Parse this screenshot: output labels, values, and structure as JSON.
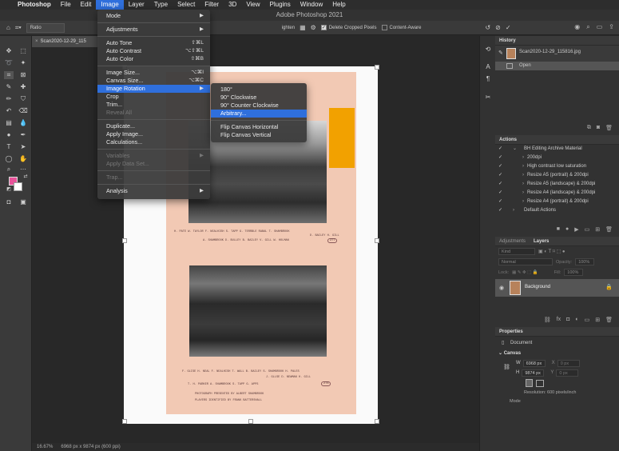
{
  "menubar": {
    "apple": "",
    "app_name": "Photoshop",
    "items": [
      "File",
      "Edit",
      "Image",
      "Layer",
      "Type",
      "Select",
      "Filter",
      "3D",
      "View",
      "Plugins",
      "Window",
      "Help"
    ],
    "active": "Image"
  },
  "window_title": "Adobe Photoshop 2021",
  "options_bar": {
    "ratio_label": "Ratio",
    "straighten_label": "ighten",
    "delete_cropped_label": "Delete Cropped Pixels",
    "delete_cropped_checked": true,
    "content_aware_label": "Content-Aware",
    "content_aware_checked": false
  },
  "document_tab": {
    "name": "Scan2020-12-29_115",
    "close": "×"
  },
  "image_menu": {
    "items": [
      {
        "label": "Mode",
        "shortcut": "",
        "submenu": true
      },
      {
        "sep": true
      },
      {
        "label": "Adjustments",
        "shortcut": "",
        "submenu": true
      },
      {
        "sep": true
      },
      {
        "label": "Auto Tone",
        "shortcut": "⇧⌘L"
      },
      {
        "label": "Auto Contrast",
        "shortcut": "⌥⇧⌘L"
      },
      {
        "label": "Auto Color",
        "shortcut": "⇧⌘B"
      },
      {
        "sep": true
      },
      {
        "label": "Image Size...",
        "shortcut": "⌥⌘I"
      },
      {
        "label": "Canvas Size...",
        "shortcut": "⌥⌘C"
      },
      {
        "label": "Image Rotation",
        "shortcut": "",
        "submenu": true,
        "highlighted": true
      },
      {
        "label": "Crop",
        "shortcut": ""
      },
      {
        "label": "Trim...",
        "shortcut": ""
      },
      {
        "label": "Reveal All",
        "shortcut": "",
        "disabled": true
      },
      {
        "sep": true
      },
      {
        "label": "Duplicate...",
        "shortcut": ""
      },
      {
        "label": "Apply Image...",
        "shortcut": ""
      },
      {
        "label": "Calculations...",
        "shortcut": ""
      },
      {
        "sep": true
      },
      {
        "label": "Variables",
        "shortcut": "",
        "submenu": true,
        "disabled": true
      },
      {
        "label": "Apply Data Set...",
        "shortcut": "",
        "disabled": true
      },
      {
        "sep": true
      },
      {
        "label": "Trap...",
        "shortcut": "",
        "disabled": true
      },
      {
        "sep": true
      },
      {
        "label": "Analysis",
        "shortcut": "",
        "submenu": true
      }
    ]
  },
  "rotation_submenu": {
    "items": [
      {
        "label": "180°"
      },
      {
        "label": "90° Clockwise"
      },
      {
        "label": "90° Counter Clockwise"
      },
      {
        "label": "Arbitrary...",
        "highlighted": true
      },
      {
        "sep": true
      },
      {
        "label": "Flip Canvas Horizontal"
      },
      {
        "label": "Flip Canvas Vertical"
      }
    ]
  },
  "photo_captions": {
    "top_line1": "H. PATE  W. TAYLOR  F. NEALHISH  S. TAPP  G. TERRBLE  RABAL    T. SHAMBROOK",
    "top_line1b": "D. BAILEY   H. GILL",
    "top_line2": "A. SHAMBROOK  D. BULLEY  B. BAILEY  V. GILL  W. HOLMAN",
    "top_tag": "277",
    "bottom_line1": "F. GLISE  H. NEAL  F. NEALHISH      T. WALL  B. BAILEY  S. SHAMBROOK  H. PALES",
    "bottom_line1b": "J. GLLSE   D. NEWMAN    H. GILL",
    "bottom_line2": "T.  H. PARKER   A. SHAMBROOK   S. TAPP   G. APPS",
    "bottom_tag": "278",
    "bottom_line3": "PHOTOGRAPH PRESENTED BY ALBERT SHAMBROOK",
    "bottom_line4": "PLAYERS IDENTIFIED BY FRANK BATTERSHALL"
  },
  "status": {
    "zoom": "16.67%",
    "doc_info": "6968 px x 9874 px (600 ppi)"
  },
  "history": {
    "title": "History",
    "snapshot": "Scan2020-12-29_115816.jpg",
    "open": "Open"
  },
  "actions": {
    "title": "Actions",
    "items": [
      {
        "label": "BH Editing Archive Material",
        "level": 0,
        "folder": true
      },
      {
        "label": "200dpi",
        "level": 1
      },
      {
        "label": "High contrast low saturation",
        "level": 1
      },
      {
        "label": "Resize A5 (portrait) & 200dpi",
        "level": 1
      },
      {
        "label": "Resize A5 (landscape) & 200dpi",
        "level": 1
      },
      {
        "label": "Resize A4 (landscape) & 200dpi",
        "level": 1
      },
      {
        "label": "Resize A4 (portrait) & 200dpi",
        "level": 1
      },
      {
        "label": "Default Actions",
        "level": 0,
        "folder": true
      }
    ]
  },
  "layers": {
    "tab_adjustments": "Adjustments",
    "tab_layers": "Layers",
    "kind": "Kind",
    "blend": "Normal",
    "opacity_label": "Opacity:",
    "opacity": "100%",
    "lock_label": "Lock:",
    "fill_label": "Fill:",
    "fill": "100%",
    "layer_name": "Background"
  },
  "properties": {
    "title": "Properties",
    "document": "Document",
    "canvas_label": "Canvas",
    "w_label": "W",
    "w_value": "6968 px",
    "h_label": "H",
    "h_value": "9874 px",
    "x_label": "X",
    "y_label": "Y",
    "resolution": "Resolution: 600 pixels/inch",
    "mode": "Mode"
  },
  "colors": {
    "foreground": "#e8539a",
    "background": "#ffffff",
    "accent": "#2f6fdc",
    "orange_strip": "#f2a100"
  }
}
